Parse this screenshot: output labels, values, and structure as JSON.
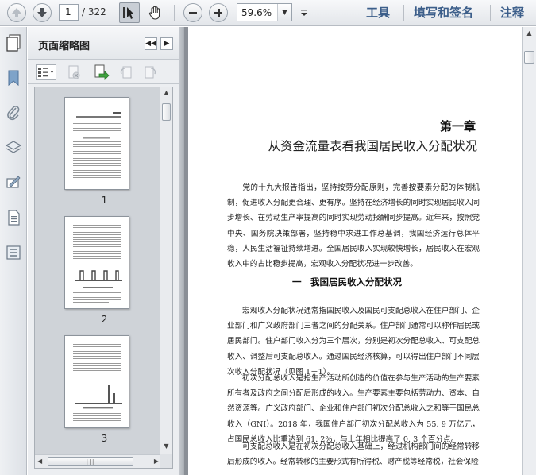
{
  "toolbar": {
    "page_current": "1",
    "page_total": "/ 322",
    "zoom": "59.6%",
    "links": [
      "工具",
      "填写和签名",
      "注释"
    ]
  },
  "panel": {
    "title": "页面缩略图",
    "thumbnails": [
      {
        "label": "1"
      },
      {
        "label": "2"
      },
      {
        "label": "3"
      }
    ]
  },
  "document": {
    "chapter_num": "第一章",
    "chapter_title": "从资金流量表看我国居民收入分配状况",
    "para1": "党的十九大报告指出，坚持按劳分配原则，完善按要素分配的体制机制，促进收入分配更合理、更有序。坚持在经济增长的同时实现居民收入同步增长、在劳动生产率提高的同时实现劳动报酬同步提高。近年来，按照党中央、国务院决策部署，坚持稳中求进工作总基调，我国经济运行总体平稳，人民生活福祉持续增进。全国居民收入实现较快增长，居民收入在宏观收入中的占比稳步提高，宏观收入分配状况进一步改善。",
    "section_title": "一　我国居民收入分配状况",
    "para2": "宏观收入分配状况通常指国民收入及国民可支配总收入在住户部门、企业部门和广义政府部门三者之间的分配关系。住户部门通常可以称作居民或居民部门。住户部门收入分为三个层次，分别是初次分配总收入、可支配总收入、调整后可支配总收入。通过国民经济核算，可以得出住户部门不同层次收入分配状况（见图 1－1）。",
    "para3": "初次分配总收入是指生产活动所创造的价值在参与生产活动的生产要素所有者及政府之间分配后形成的收入。生产要素主要包括劳动力、资本、自然资源等。广义政府部门、企业和住户部门初次分配总收入之和等于国民总收入（GNI）。2018 年，我国住户部门初次分配总收入为 55. 9 万亿元，占国民总收入比重达到 61. 2%，与上年相比提高了 0. 3 个百分点。",
    "para4": "可支配总收入是在初次分配总收入基础上，经过机构部门间的经常转移后形成的收入。经常转移的主要形式有所得税、财产税等经常税，社会保险"
  },
  "colors": {
    "accent_link": "#3c5e8a",
    "rail_icon": "#5b7fa8"
  }
}
